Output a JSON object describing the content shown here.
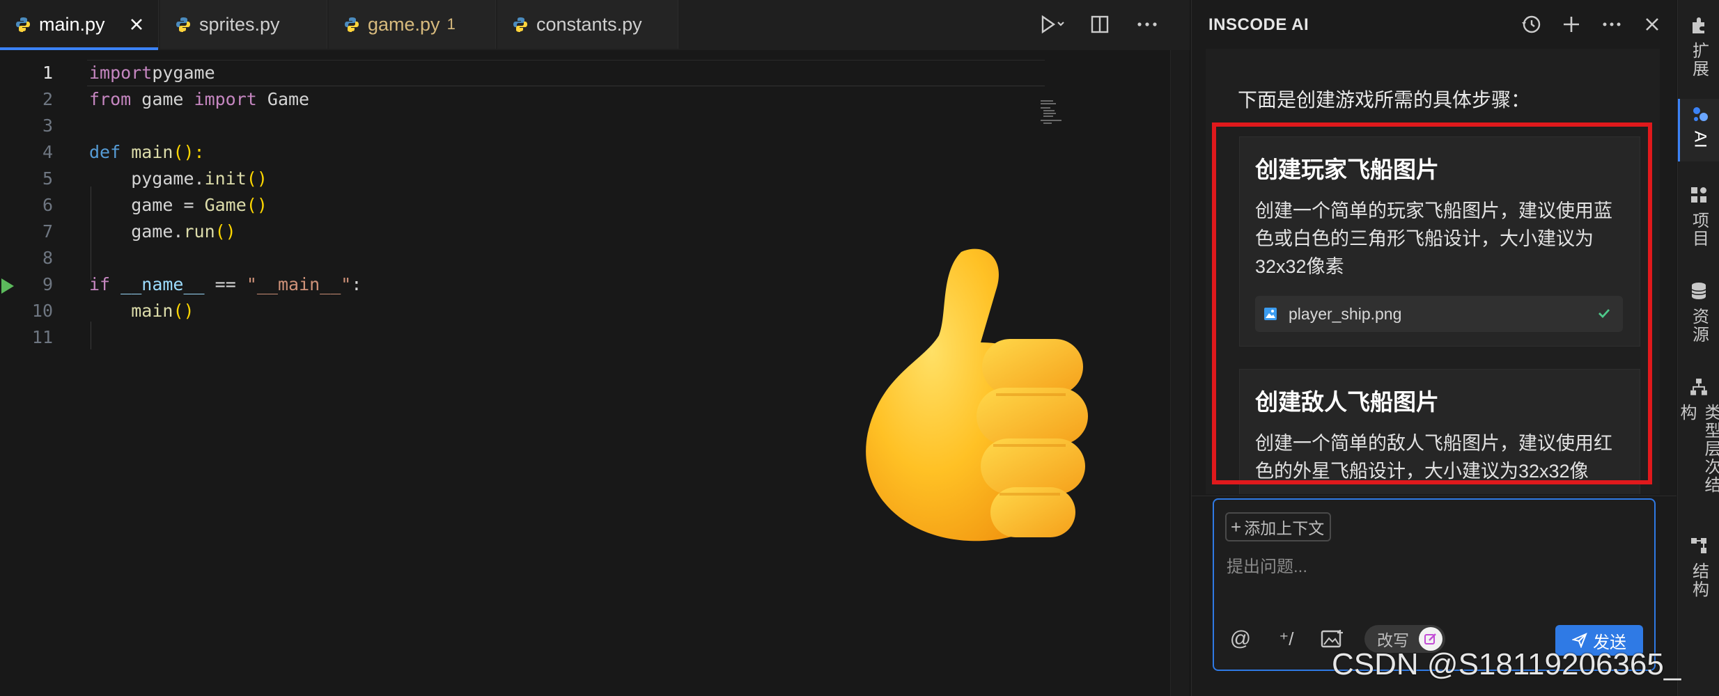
{
  "tabs": [
    {
      "label": "main.py",
      "active": true,
      "close": "✕"
    },
    {
      "label": "sprites.py"
    },
    {
      "label": "game.py",
      "modified_count": "1"
    },
    {
      "label": "constants.py"
    }
  ],
  "editor": {
    "line_numbers": [
      "1",
      "2",
      "3",
      "4",
      "5",
      "6",
      "7",
      "8",
      "9",
      "10",
      "11"
    ],
    "lines": [
      [
        [
          "kw",
          "import"
        ],
        [
          "",
          "pygame"
        ]
      ],
      [
        [
          "kw",
          "from"
        ],
        [
          "",
          " game "
        ],
        [
          "kw",
          "import"
        ],
        [
          "",
          " Game"
        ]
      ],
      [],
      [
        [
          "kwb",
          "def"
        ],
        [
          "",
          " "
        ],
        [
          "fn",
          "main"
        ],
        [
          "par",
          "():"
        ]
      ],
      [
        [
          "",
          "    pygame."
        ],
        [
          "fn",
          "init"
        ],
        [
          "par",
          "()"
        ]
      ],
      [
        [
          "",
          "    game = "
        ],
        [
          "fn",
          "Game"
        ],
        [
          "par",
          "()"
        ]
      ],
      [
        [
          "",
          "    game."
        ],
        [
          "fn",
          "run"
        ],
        [
          "par",
          "()"
        ]
      ],
      [],
      [
        [
          "kw",
          "if"
        ],
        [
          "",
          " "
        ],
        [
          "var",
          "__name__"
        ],
        [
          "",
          " == "
        ],
        [
          "str",
          "\"__main__\""
        ],
        [
          "",
          ":"
        ]
      ],
      [
        [
          "",
          "    "
        ],
        [
          "fn",
          "main"
        ],
        [
          "par",
          "()"
        ]
      ],
      []
    ]
  },
  "ai_panel": {
    "title": "INSCODE AI",
    "intro": "下面是创建游戏所需的具体步骤：",
    "cards": [
      {
        "title": "创建玩家飞船图片",
        "desc": "创建一个简单的玩家飞船图片，建议使用蓝色或白色的三角形飞船设计，大小建议为32x32像素",
        "file": "player_ship.png"
      },
      {
        "title": "创建敌人飞船图片",
        "desc": "创建一个简单的敌人飞船图片，建议使用红色的外星飞船设计，大小建议为32x32像"
      }
    ],
    "input": {
      "add_context": "添加上下文",
      "placeholder": "提出问题...",
      "at_symbol": "@",
      "slash_symbol": "⁺/",
      "rewrite": "改写",
      "send": "发送"
    }
  },
  "rail": [
    {
      "label": "扩展"
    },
    {
      "label": "AI",
      "active": true
    },
    {
      "label": "项目"
    },
    {
      "label": "资源"
    },
    {
      "label": "类型层次结构"
    },
    {
      "label": "结构"
    }
  ],
  "watermark": "CSDN @S18119206365_"
}
